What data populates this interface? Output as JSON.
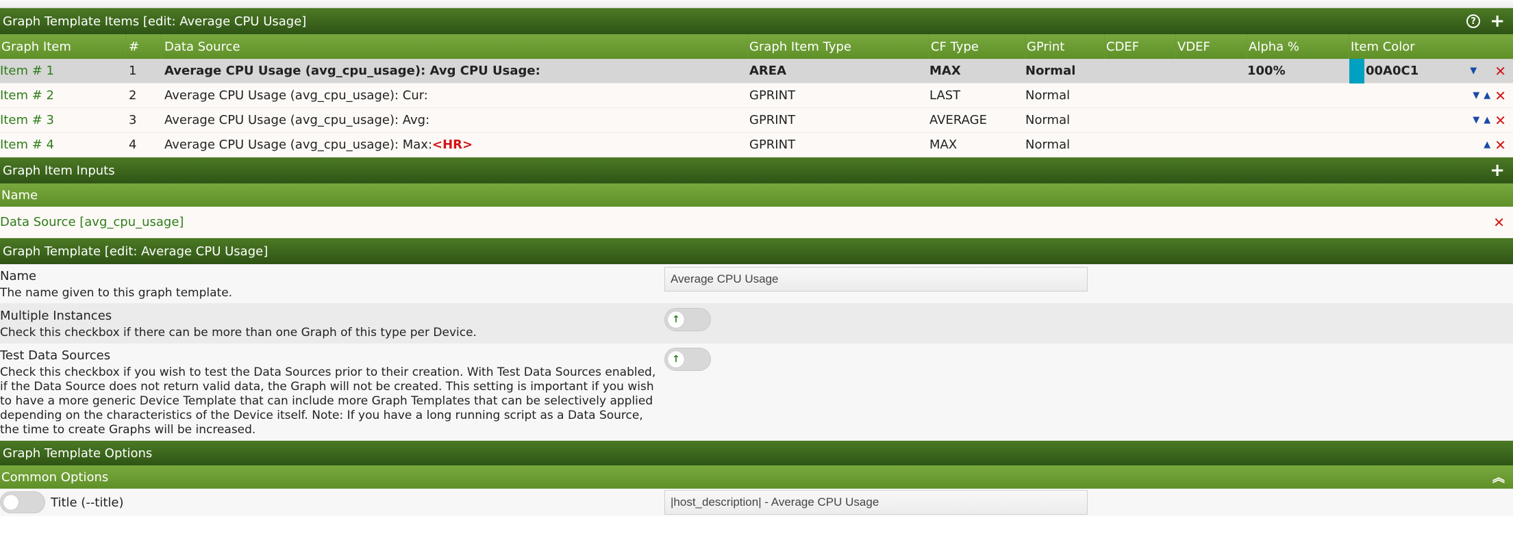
{
  "items_section": {
    "title": "Graph Template Items [edit: Average CPU Usage]",
    "help_icon": "?",
    "add_icon": "+"
  },
  "items_table": {
    "columns": [
      "Graph Item",
      "#",
      "Data Source",
      "Graph Item Type",
      "CF Type",
      "GPrint",
      "CDEF",
      "VDEF",
      "Alpha %",
      "Item Color"
    ],
    "rows": [
      {
        "item": "Item # 1",
        "num": "1",
        "ds": "Average CPU Usage (avg_cpu_usage): Avg CPU Usage:",
        "hr": "",
        "type": "AREA",
        "cf": "MAX",
        "gprint": "Normal",
        "cdef": "",
        "vdef": "",
        "alpha": "100%",
        "color": "00A0C1",
        "color_hex": "#00A0C1"
      },
      {
        "item": "Item # 2",
        "num": "2",
        "ds": "Average CPU Usage (avg_cpu_usage): Cur:",
        "hr": "",
        "type": "GPRINT",
        "cf": "LAST",
        "gprint": "Normal",
        "cdef": "",
        "vdef": "",
        "alpha": "",
        "color": ""
      },
      {
        "item": "Item # 3",
        "num": "3",
        "ds": "Average CPU Usage (avg_cpu_usage): Avg:",
        "hr": "",
        "type": "GPRINT",
        "cf": "AVERAGE",
        "gprint": "Normal",
        "cdef": "",
        "vdef": "",
        "alpha": "",
        "color": ""
      },
      {
        "item": "Item # 4",
        "num": "4",
        "ds": "Average CPU Usage (avg_cpu_usage): Max:",
        "hr": "<HR>",
        "type": "GPRINT",
        "cf": "MAX",
        "gprint": "Normal",
        "cdef": "",
        "vdef": "",
        "alpha": "",
        "color": ""
      }
    ]
  },
  "inputs_section": {
    "title": "Graph Item Inputs",
    "add_icon": "+",
    "column": "Name",
    "rows": [
      {
        "name": "Data Source [avg_cpu_usage]"
      }
    ]
  },
  "template_section": {
    "title": "Graph Template [edit: Average CPU Usage]",
    "name_label": "Name",
    "name_desc": "The name given to this graph template.",
    "name_value": "Average CPU Usage",
    "multi_label": "Multiple Instances",
    "multi_desc": "Check this checkbox if there can be more than one Graph of this type per Device.",
    "test_label": "Test Data Sources",
    "test_desc": "Check this checkbox if you wish to test the Data Sources prior to their creation. With Test Data Sources enabled, if the Data Source does not return valid data, the Graph will not be created. This setting is important if you wish to have a more generic Device Template that can include more Graph Templates that can be selectively applied depending on the characteristics of the Device itself. Note: If you have a long running script as a Data Source, the time to create Graphs will be increased."
  },
  "options_section": {
    "title": "Graph Template Options",
    "common_title": "Common Options",
    "title_label": "Title (--title)",
    "title_value": "|host_description| - Average CPU Usage"
  },
  "colors": {
    "header_dark": "#2e5415",
    "header_light": "#6a9a34",
    "link_green": "#2e7d1a",
    "delete_red": "#d21414",
    "arrow_blue": "#1a4aa8"
  }
}
